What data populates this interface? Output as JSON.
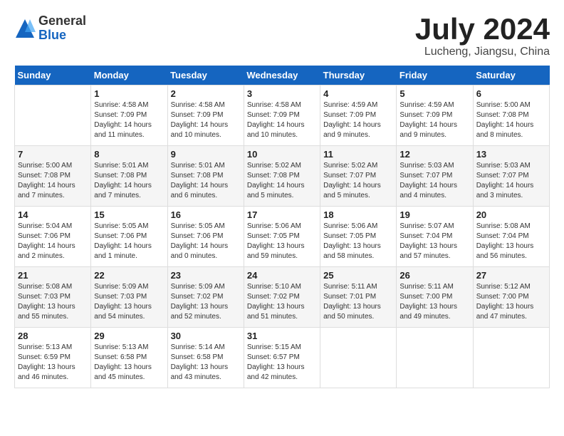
{
  "logo": {
    "general": "General",
    "blue": "Blue"
  },
  "title": "July 2024",
  "location": "Lucheng, Jiangsu, China",
  "days_of_week": [
    "Sunday",
    "Monday",
    "Tuesday",
    "Wednesday",
    "Thursday",
    "Friday",
    "Saturday"
  ],
  "weeks": [
    [
      {
        "day": "",
        "info": ""
      },
      {
        "day": "1",
        "info": "Sunrise: 4:58 AM\nSunset: 7:09 PM\nDaylight: 14 hours\nand 11 minutes."
      },
      {
        "day": "2",
        "info": "Sunrise: 4:58 AM\nSunset: 7:09 PM\nDaylight: 14 hours\nand 10 minutes."
      },
      {
        "day": "3",
        "info": "Sunrise: 4:58 AM\nSunset: 7:09 PM\nDaylight: 14 hours\nand 10 minutes."
      },
      {
        "day": "4",
        "info": "Sunrise: 4:59 AM\nSunset: 7:09 PM\nDaylight: 14 hours\nand 9 minutes."
      },
      {
        "day": "5",
        "info": "Sunrise: 4:59 AM\nSunset: 7:09 PM\nDaylight: 14 hours\nand 9 minutes."
      },
      {
        "day": "6",
        "info": "Sunrise: 5:00 AM\nSunset: 7:08 PM\nDaylight: 14 hours\nand 8 minutes."
      }
    ],
    [
      {
        "day": "7",
        "info": "Sunrise: 5:00 AM\nSunset: 7:08 PM\nDaylight: 14 hours\nand 7 minutes."
      },
      {
        "day": "8",
        "info": "Sunrise: 5:01 AM\nSunset: 7:08 PM\nDaylight: 14 hours\nand 7 minutes."
      },
      {
        "day": "9",
        "info": "Sunrise: 5:01 AM\nSunset: 7:08 PM\nDaylight: 14 hours\nand 6 minutes."
      },
      {
        "day": "10",
        "info": "Sunrise: 5:02 AM\nSunset: 7:08 PM\nDaylight: 14 hours\nand 5 minutes."
      },
      {
        "day": "11",
        "info": "Sunrise: 5:02 AM\nSunset: 7:07 PM\nDaylight: 14 hours\nand 5 minutes."
      },
      {
        "day": "12",
        "info": "Sunrise: 5:03 AM\nSunset: 7:07 PM\nDaylight: 14 hours\nand 4 minutes."
      },
      {
        "day": "13",
        "info": "Sunrise: 5:03 AM\nSunset: 7:07 PM\nDaylight: 14 hours\nand 3 minutes."
      }
    ],
    [
      {
        "day": "14",
        "info": "Sunrise: 5:04 AM\nSunset: 7:06 PM\nDaylight: 14 hours\nand 2 minutes."
      },
      {
        "day": "15",
        "info": "Sunrise: 5:05 AM\nSunset: 7:06 PM\nDaylight: 14 hours\nand 1 minute."
      },
      {
        "day": "16",
        "info": "Sunrise: 5:05 AM\nSunset: 7:06 PM\nDaylight: 14 hours\nand 0 minutes."
      },
      {
        "day": "17",
        "info": "Sunrise: 5:06 AM\nSunset: 7:05 PM\nDaylight: 13 hours\nand 59 minutes."
      },
      {
        "day": "18",
        "info": "Sunrise: 5:06 AM\nSunset: 7:05 PM\nDaylight: 13 hours\nand 58 minutes."
      },
      {
        "day": "19",
        "info": "Sunrise: 5:07 AM\nSunset: 7:04 PM\nDaylight: 13 hours\nand 57 minutes."
      },
      {
        "day": "20",
        "info": "Sunrise: 5:08 AM\nSunset: 7:04 PM\nDaylight: 13 hours\nand 56 minutes."
      }
    ],
    [
      {
        "day": "21",
        "info": "Sunrise: 5:08 AM\nSunset: 7:03 PM\nDaylight: 13 hours\nand 55 minutes."
      },
      {
        "day": "22",
        "info": "Sunrise: 5:09 AM\nSunset: 7:03 PM\nDaylight: 13 hours\nand 54 minutes."
      },
      {
        "day": "23",
        "info": "Sunrise: 5:09 AM\nSunset: 7:02 PM\nDaylight: 13 hours\nand 52 minutes."
      },
      {
        "day": "24",
        "info": "Sunrise: 5:10 AM\nSunset: 7:02 PM\nDaylight: 13 hours\nand 51 minutes."
      },
      {
        "day": "25",
        "info": "Sunrise: 5:11 AM\nSunset: 7:01 PM\nDaylight: 13 hours\nand 50 minutes."
      },
      {
        "day": "26",
        "info": "Sunrise: 5:11 AM\nSunset: 7:00 PM\nDaylight: 13 hours\nand 49 minutes."
      },
      {
        "day": "27",
        "info": "Sunrise: 5:12 AM\nSunset: 7:00 PM\nDaylight: 13 hours\nand 47 minutes."
      }
    ],
    [
      {
        "day": "28",
        "info": "Sunrise: 5:13 AM\nSunset: 6:59 PM\nDaylight: 13 hours\nand 46 minutes."
      },
      {
        "day": "29",
        "info": "Sunrise: 5:13 AM\nSunset: 6:58 PM\nDaylight: 13 hours\nand 45 minutes."
      },
      {
        "day": "30",
        "info": "Sunrise: 5:14 AM\nSunset: 6:58 PM\nDaylight: 13 hours\nand 43 minutes."
      },
      {
        "day": "31",
        "info": "Sunrise: 5:15 AM\nSunset: 6:57 PM\nDaylight: 13 hours\nand 42 minutes."
      },
      {
        "day": "",
        "info": ""
      },
      {
        "day": "",
        "info": ""
      },
      {
        "day": "",
        "info": ""
      }
    ]
  ],
  "accent_color": "#1565c0"
}
